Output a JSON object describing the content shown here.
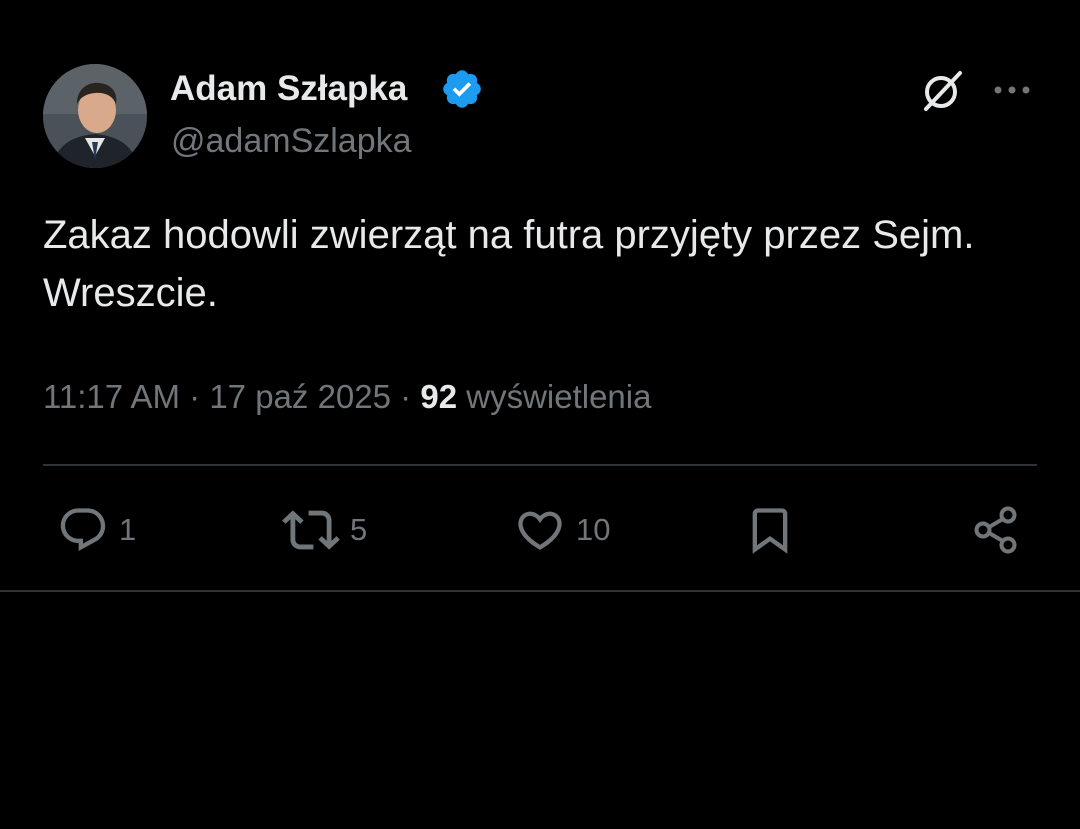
{
  "author": {
    "display_name": "Adam Szłapka",
    "handle": "@adamSzlapka",
    "verified": true
  },
  "tweet": {
    "text": "Zakaz hodowli zwierząt na futra przyjęty przez Sejm. Wreszcie.",
    "time": "11:17 AM",
    "date": "17 paź 2025",
    "views_count": "92",
    "views_label": "wyświetlenia",
    "separator": "·"
  },
  "actions": {
    "reply_count": "1",
    "retweet_count": "5",
    "like_count": "10"
  },
  "icons": {
    "verified": "verified-badge-icon",
    "grok": "grok-icon",
    "more": "more-icon",
    "reply": "reply-icon",
    "retweet": "retweet-icon",
    "like": "heart-icon",
    "bookmark": "bookmark-icon",
    "share": "share-icon"
  },
  "colors": {
    "background": "#000000",
    "primary_text": "#e7e9ea",
    "secondary_text": "#71767b",
    "verified_blue": "#1d9bf0",
    "divider": "#2f3336"
  }
}
